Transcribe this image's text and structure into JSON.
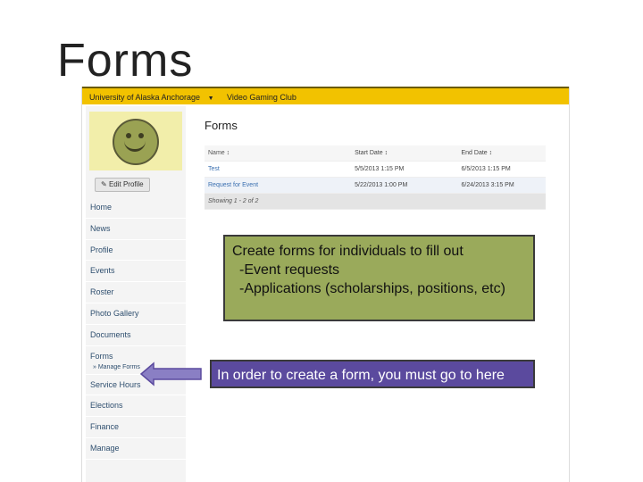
{
  "slide": {
    "title": "Forms"
  },
  "topbar": {
    "org": "University of Alaska Anchorage",
    "club": "Video Gaming Club"
  },
  "sidebar": {
    "edit_profile": "Edit Profile",
    "items": [
      {
        "label": "Home"
      },
      {
        "label": "News"
      },
      {
        "label": "Profile"
      },
      {
        "label": "Events"
      },
      {
        "label": "Roster"
      },
      {
        "label": "Photo Gallery"
      },
      {
        "label": "Documents"
      },
      {
        "label": "Forms"
      },
      {
        "label": "» Manage Forms"
      },
      {
        "label": "Service Hours"
      },
      {
        "label": "Elections"
      },
      {
        "label": "Finance"
      },
      {
        "label": "Manage"
      }
    ]
  },
  "content": {
    "title": "Forms",
    "table": {
      "headers": [
        "Name ↕",
        "Start Date ↕",
        "End Date ↕"
      ],
      "rows": [
        [
          "Test",
          "5/5/2013 1:15 PM",
          "6/5/2013 1:15 PM"
        ],
        [
          "Request for Event",
          "5/22/2013 1:00 PM",
          "6/24/2013 3:15 PM"
        ]
      ],
      "showing": "Showing 1 - 2 of 2"
    }
  },
  "callouts": {
    "box1": [
      "Create forms for individuals to fill out",
      "-Event requests",
      "-Applications (scholarships, positions, etc)"
    ],
    "box2": "In order to create a form, you must go to here"
  },
  "colors": {
    "topbar": "#f2c200",
    "callout1": "#9aaa5b",
    "callout2": "#5b4a9e",
    "arrow": "#8a7fc4"
  }
}
